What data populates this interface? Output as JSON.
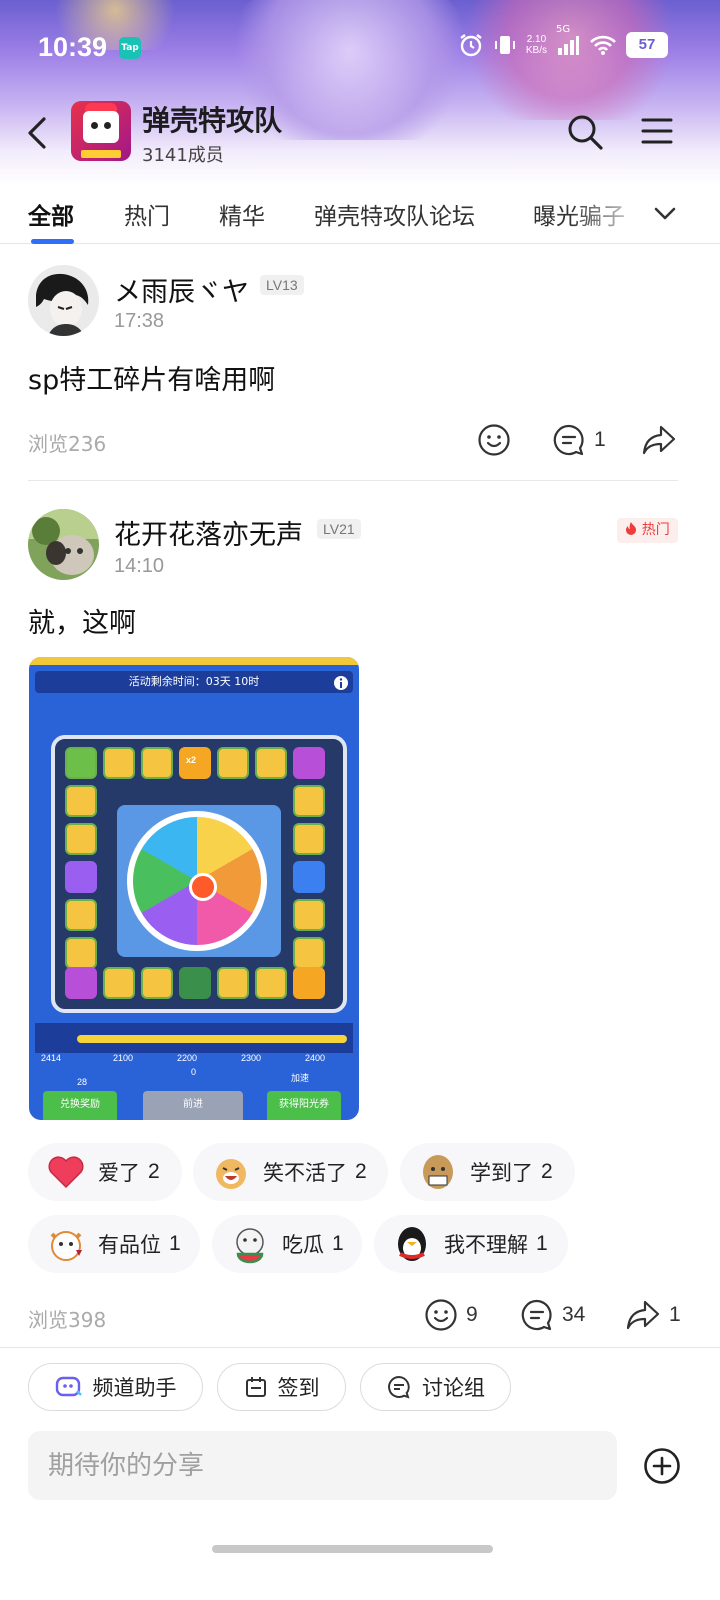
{
  "status_bar": {
    "time": "10:39",
    "tap_badge": "Tap",
    "net_speed_value": "2.10",
    "net_speed_unit": "KB/s",
    "network": "5G",
    "battery": "57"
  },
  "header": {
    "group_name": "弹壳特攻队",
    "member_count": "3141成员"
  },
  "tabs": [
    "全部",
    "热门",
    "精华",
    "弹壳特攻队论坛",
    "曝光骗子"
  ],
  "posts": [
    {
      "author": "メ雨辰ヾヤ",
      "level": "LV13",
      "time": "17:38",
      "text": "sp特工碎片有啥用啊",
      "views": "浏览236",
      "comments": "1"
    },
    {
      "author": "花开花落亦无声",
      "level": "LV21",
      "time": "14:10",
      "hot_badge": "热门",
      "text": "就，这啊",
      "image": {
        "timer": "活动剩余时间：03天 10时",
        "track_labels": [
          "2414",
          "2100",
          "2200",
          "2300",
          "2400"
        ],
        "coins": "28",
        "step": "0",
        "speed_label": "加速",
        "btn_exchange": "兑换奖励",
        "btn_forward": "前进",
        "btn_forward_count": "x1",
        "btn_get": "获得阳光券",
        "multiplier": "x2",
        "coin_values": [
          "+6",
          "+12",
          "+20",
          "+50",
          "+50",
          "+20",
          "+32",
          "+6",
          "+12",
          "+32",
          "+50"
        ]
      },
      "reactions": [
        {
          "label": "爱了",
          "count": "2"
        },
        {
          "label": "笑不活了",
          "count": "2"
        },
        {
          "label": "学到了",
          "count": "2"
        },
        {
          "label": "有品位",
          "count": "1"
        },
        {
          "label": "吃瓜",
          "count": "1"
        },
        {
          "label": "我不理解",
          "count": "1"
        }
      ],
      "views": "浏览398",
      "likes": "9",
      "comments": "34",
      "shares": "1"
    }
  ],
  "bottom": {
    "chips": [
      "频道助手",
      "签到",
      "讨论组"
    ],
    "composer_placeholder": "期待你的分享"
  },
  "colors": {
    "accent": "#2f6ef6",
    "hot": "#ee3b3b",
    "chip_icon": "#6b5ff0"
  }
}
